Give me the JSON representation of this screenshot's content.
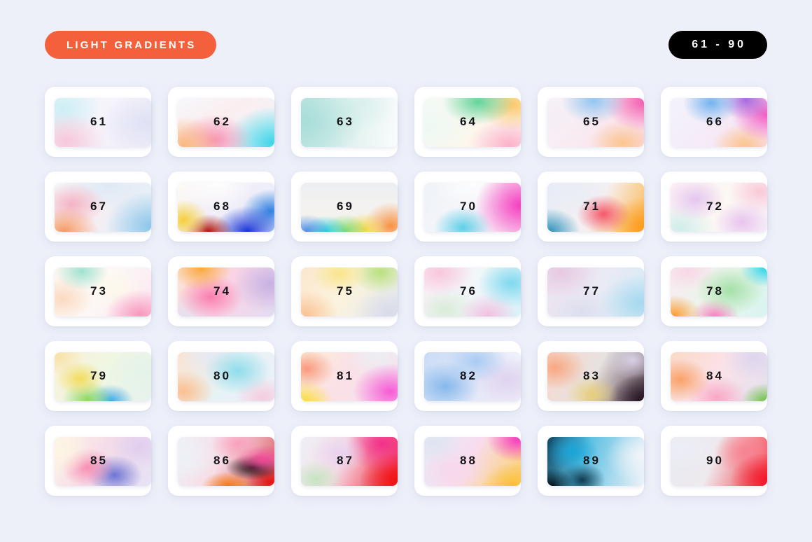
{
  "header": {
    "title_label": "LIGHT GRADIENTS",
    "range_label": "61 - 90",
    "title_bg": "#f4603c",
    "range_bg": "#000000",
    "text_color": "#ffffff"
  },
  "page": {
    "background": "#edf0f9",
    "card_background": "#ffffff",
    "number_color": "#141418",
    "columns": 6,
    "rows": 5,
    "total_swatches": 30
  },
  "swatches": [
    {
      "number": "61",
      "description": "pale cyan lavender pink"
    },
    {
      "number": "62",
      "description": "orange pink cyan diagonal"
    },
    {
      "number": "63",
      "description": "soft teal to white"
    },
    {
      "number": "64",
      "description": "green yellow orange pink"
    },
    {
      "number": "65",
      "description": "blue pink magenta"
    },
    {
      "number": "66",
      "description": "blue purple magenta diagonal"
    },
    {
      "number": "67",
      "description": "orange pink blue"
    },
    {
      "number": "68",
      "description": "yellow dark red deep blue"
    },
    {
      "number": "69",
      "description": "rainbow band bottom"
    },
    {
      "number": "70",
      "description": "cyan hot magenta"
    },
    {
      "number": "71",
      "description": "teal blue to red orange"
    },
    {
      "number": "72",
      "description": "pastel lavender pink mint"
    },
    {
      "number": "73",
      "description": "mint top left pink bottom right"
    },
    {
      "number": "74",
      "description": "orange pink lavender"
    },
    {
      "number": "75",
      "description": "peach yellow green pastel"
    },
    {
      "number": "76",
      "description": "pink to cyan"
    },
    {
      "number": "77",
      "description": "muted lilac light blue"
    },
    {
      "number": "78",
      "description": "cyan green orange pink"
    },
    {
      "number": "79",
      "description": "diagonal rainbow yellow green blue"
    },
    {
      "number": "80",
      "description": "peach to cyan"
    },
    {
      "number": "81",
      "description": "yellow to pink magenta"
    },
    {
      "number": "82",
      "description": "blue periwinkle lavender"
    },
    {
      "number": "83",
      "description": "orange salmon to dark brown"
    },
    {
      "number": "84",
      "description": "orange pink green"
    },
    {
      "number": "85",
      "description": "cream pink blue violet"
    },
    {
      "number": "86",
      "description": "pink dark band orange red"
    },
    {
      "number": "87",
      "description": "pale to vivid crimson"
    },
    {
      "number": "88",
      "description": "magenta to yellow orange"
    },
    {
      "number": "89",
      "description": "bright cyan dark navy"
    },
    {
      "number": "90",
      "description": "grey white to red coral"
    }
  ]
}
